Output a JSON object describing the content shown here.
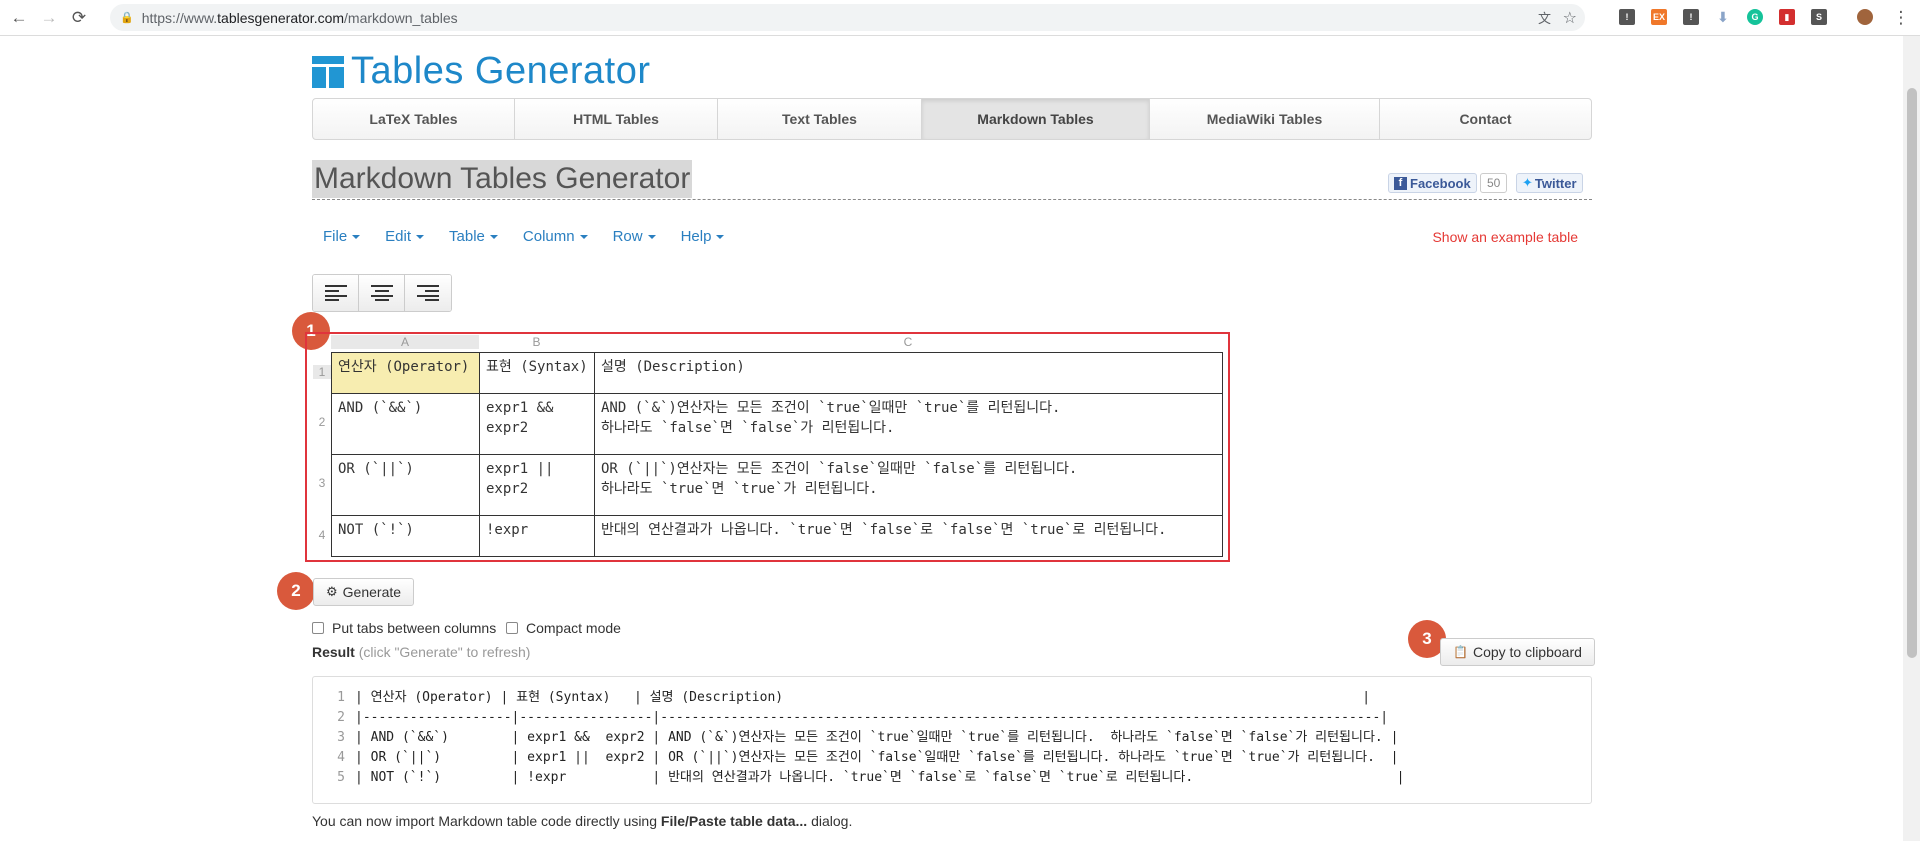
{
  "browser": {
    "url_prefix": "https://www.",
    "url_host": "tablesgenerator.com",
    "url_path": "/markdown_tables"
  },
  "logo": {
    "text": "Tables Generator"
  },
  "nav_tabs": [
    {
      "label": "LaTeX Tables"
    },
    {
      "label": "HTML Tables"
    },
    {
      "label": "Text Tables"
    },
    {
      "label": "Markdown Tables",
      "active": true
    },
    {
      "label": "MediaWiki Tables"
    },
    {
      "label": "Contact"
    }
  ],
  "page_title": "Markdown Tables Generator",
  "social": {
    "facebook": "Facebook",
    "facebook_count": "50",
    "twitter": "Twitter"
  },
  "menus": [
    {
      "label": "File"
    },
    {
      "label": "Edit"
    },
    {
      "label": "Table"
    },
    {
      "label": "Column"
    },
    {
      "label": "Row"
    },
    {
      "label": "Help"
    }
  ],
  "example_link": "Show an example table",
  "badges": [
    "1",
    "2",
    "3"
  ],
  "grid": {
    "column_headers": [
      "A",
      "B",
      "C"
    ],
    "row_numbers": [
      "1",
      "2",
      "3",
      "4"
    ],
    "rows": [
      [
        "연산자 (Operator)",
        "표현 (Syntax)",
        "설명 (Description)"
      ],
      [
        "AND (`&&`)",
        "expr1 &&\nexpr2",
        "AND (`&`)연산자는 모든 조건이 `true`일때만 `true`를 리턴됩니다.\n하나라도 `false`면 `false`가 리턴됩니다."
      ],
      [
        "OR (`||`)",
        "expr1 ||\nexpr2",
        "OR (`||`)연산자는 모든 조건이 `false`일때만 `false`를 리턴됩니다.\n하나라도 `true`면 `true`가 리턴됩니다."
      ],
      [
        "NOT (`!`)",
        "!expr",
        "반대의 연산결과가 나옵니다. `true`면 `false`로 `false`면 `true`로 리턴됩니다."
      ]
    ]
  },
  "generate_button": "Generate",
  "options": {
    "tabs": "Put tabs between columns",
    "compact": "Compact mode"
  },
  "result": {
    "label": "Result",
    "hint": "(click \"Generate\" to refresh)",
    "copy_button": "Copy to clipboard",
    "line_numbers": [
      "1",
      "2",
      "3",
      "4",
      "5"
    ],
    "lines": [
      "| 연산자 (Operator) | 표현 (Syntax)   | 설명 (Description)                                                                          |",
      "|-------------------|-----------------|--------------------------------------------------------------------------------------------|",
      "| AND (`&&`)        | expr1 &&  expr2 | AND (`&`)연산자는 모든 조건이 `true`일때만 `true`를 리턴됩니다.  하나라도 `false`면 `false`가 리턴됩니다. |",
      "| OR (`||`)         | expr1 ||  expr2 | OR (`||`)연산자는 모든 조건이 `false`일때만 `false`를 리턴됩니다. 하나라도 `true`면 `true`가 리턴됩니다.  |",
      "| NOT (`!`)         | !expr           | 반대의 연산결과가 나옵니다. `true`면 `false`로 `false`면 `true`로 리턴됩니다.                          |"
    ]
  },
  "footer": {
    "prefix": "You can now import Markdown table code directly using ",
    "bold": "File/Paste table data...",
    "suffix": " dialog."
  },
  "colors": {
    "accent": "#2196d3",
    "badge": "#d9593c",
    "highlight_box": "#e0343c",
    "selected_cell": "#f7edb0"
  }
}
